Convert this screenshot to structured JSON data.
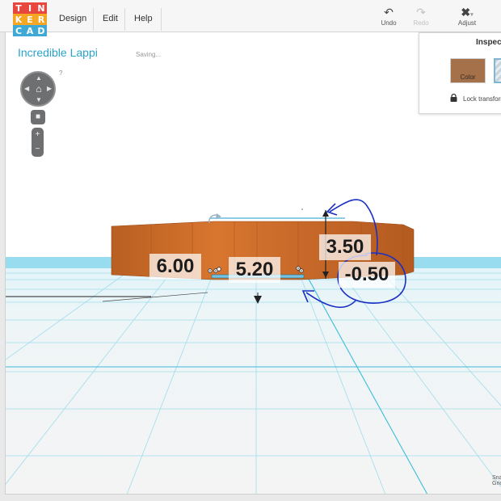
{
  "logo": {
    "letters": [
      "T",
      "I",
      "N",
      "K",
      "E",
      "R",
      "C",
      "A",
      "D"
    ],
    "colors": [
      "#e8473f",
      "#e8473f",
      "#e8473f",
      "#f5a623",
      "#f5a623",
      "#f5a623",
      "#3fa9d6",
      "#3fa9d6",
      "#3fa9d6"
    ]
  },
  "menu": {
    "design": "Design",
    "edit": "Edit",
    "help": "Help"
  },
  "toolbar": {
    "undo_label": "Undo",
    "undo_icon": "undo-arrow-icon",
    "redo_label": "Redo",
    "redo_icon": "redo-arrow-icon",
    "adjust_label": "Adjust",
    "adjust_icon": "adjust-tools-icon"
  },
  "design": {
    "title": "Incredible Lappi",
    "status": "Saving..."
  },
  "viewcontrols": {
    "help": "?",
    "zoom_in": "+",
    "zoom_out": "−"
  },
  "inspector": {
    "title": "Inspector",
    "color_label": "Color",
    "color": "#a4714a",
    "lock_label": "Lock transform"
  },
  "dimensions": {
    "length": "6.00",
    "width": "5.20",
    "height": "3.50",
    "elevation": "-0.50"
  },
  "footer": {
    "snap_label": "Snap Grid"
  },
  "colors": {
    "accent": "#2aa3c9",
    "object": "#c9672a",
    "annotation": "#1a2fc4",
    "grid": "#4fc9e6"
  }
}
